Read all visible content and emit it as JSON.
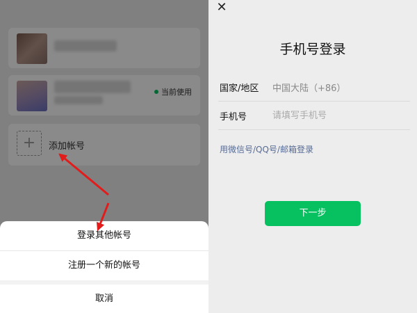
{
  "left_panel": {
    "accounts": [
      {
        "status": ""
      },
      {
        "status": "当前使用"
      }
    ],
    "add_account_label": "添加帐号",
    "add_icon": "plus-icon",
    "sheet": {
      "items": [
        "登录其他帐号",
        "注册一个新的帐号"
      ],
      "cancel": "取消"
    },
    "annotation_color": "#e21b1b"
  },
  "right_panel": {
    "close_icon": "close-icon",
    "title": "手机号登录",
    "country_label": "国家/地区",
    "country_value": "中国大陆（+86）",
    "phone_label": "手机号",
    "phone_placeholder": "请填写手机号",
    "alt_login_link": "用微信号/QQ号/邮箱登录",
    "next_button": "下一步",
    "accent_color": "#07c160",
    "link_color": "#576b95"
  }
}
